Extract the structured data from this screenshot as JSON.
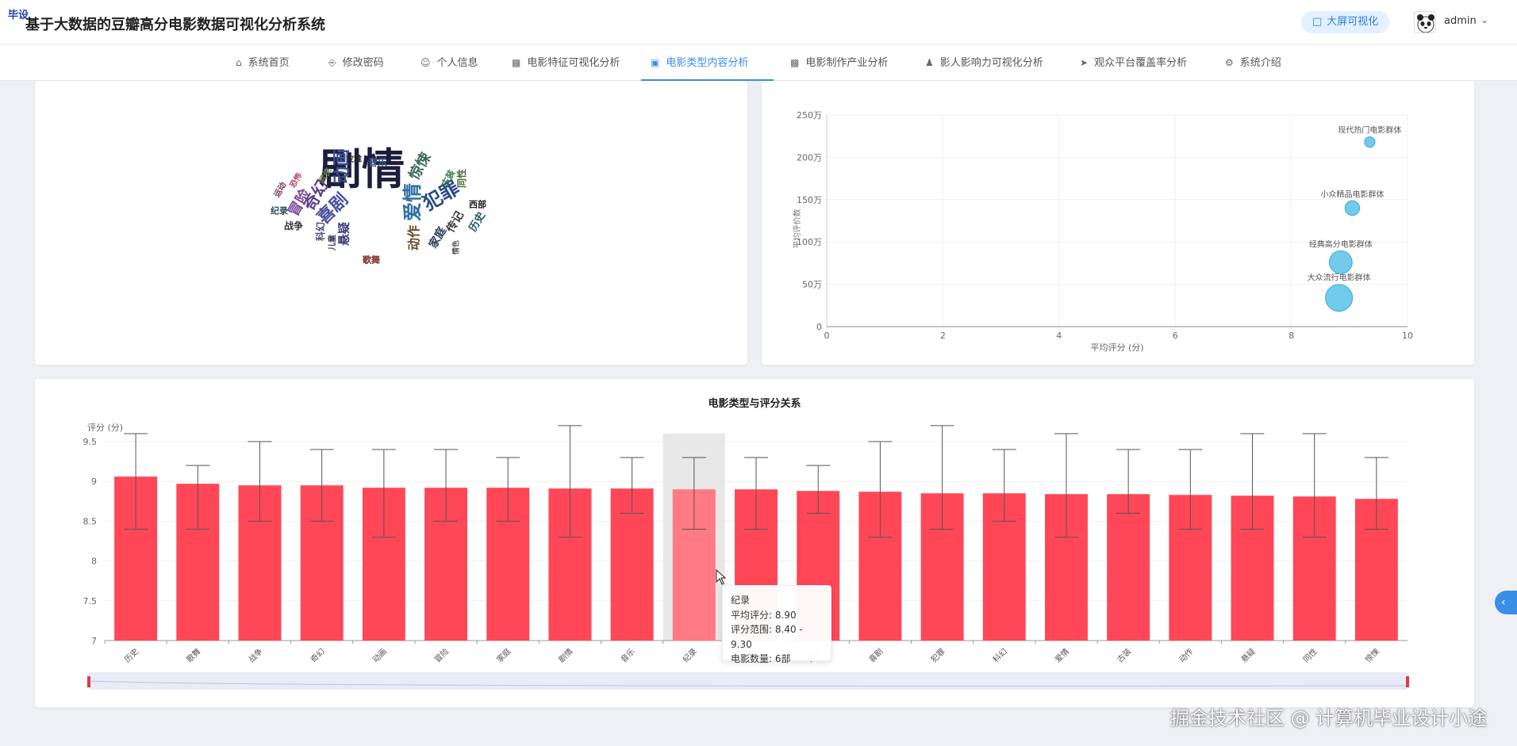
{
  "header": {
    "corner_logo": "毕设",
    "title": "基于大数据的豆瓣高分电影数据可视化分析系统",
    "bigscreen_label": "大屏可视化",
    "username": "admin"
  },
  "nav": [
    {
      "label": "系统首页",
      "icon": "home-icon"
    },
    {
      "label": "修改密码",
      "icon": "lock-icon"
    },
    {
      "label": "个人信息",
      "icon": "user-icon"
    },
    {
      "label": "电影特征可视化分析",
      "icon": "bar-chart-icon"
    },
    {
      "label": "电影类型内容分析",
      "icon": "chart-window-icon",
      "active": true
    },
    {
      "label": "电影制作产业分析",
      "icon": "monitor-icon"
    },
    {
      "label": "影人影响力可视化分析",
      "icon": "person-icon"
    },
    {
      "label": "观众平台覆盖率分析",
      "icon": "paper-plane-icon"
    },
    {
      "label": "系统介绍",
      "icon": "gear-icon"
    }
  ],
  "word_cloud": {
    "words": [
      "剧情",
      "爱情",
      "犯罪",
      "动画",
      "奇幻",
      "喜剧",
      "惊悚",
      "冒险",
      "悬疑",
      "动作",
      "家庭",
      "传记",
      "历史",
      "同性",
      "古装",
      "西部",
      "音乐",
      "灾难",
      "武侠",
      "恐怖",
      "运动",
      "纪录",
      "战争",
      "科幻",
      "歌舞",
      "情色",
      "儿童",
      "歌舞"
    ]
  },
  "scatter": {
    "x_axis_label": "平均评分 (分)",
    "y_axis_label": "平均评价数",
    "y_ticks": [
      "0",
      "50万",
      "100万",
      "150万",
      "200万",
      "250万"
    ],
    "x_ticks": [
      "0",
      "2",
      "4",
      "6",
      "8",
      "10"
    ],
    "chart_data": {
      "type": "scatter",
      "xlim": [
        0,
        10
      ],
      "ylim": [
        0,
        2500000
      ],
      "points": [
        {
          "label": "现代热门电影群体",
          "x": 9.35,
          "y": 2180000,
          "size": 1
        },
        {
          "label": "小众精品电影群体",
          "x": 9.05,
          "y": 1400000,
          "size": 2
        },
        {
          "label": "经典高分电影群体",
          "x": 8.85,
          "y": 760000,
          "size": 4
        },
        {
          "label": "大众流行电影群体",
          "x": 8.82,
          "y": 340000,
          "size": 5
        }
      ]
    }
  },
  "bar_chart": {
    "title": "电影类型与评分关系",
    "y_axis_name": "评分 (分)",
    "y_ticks": [
      "7",
      "7.5",
      "8",
      "8.5",
      "9",
      "9.5"
    ],
    "bar_color": "#ff4757",
    "chart_data": {
      "type": "bar",
      "ylim": [
        7,
        9.8
      ],
      "categories": [
        "历史",
        "歌舞",
        "战争",
        "奇幻",
        "动画",
        "冒险",
        "家庭",
        "剧情",
        "音乐",
        "纪录",
        "同性",
        "传记",
        "喜剧",
        "犯罪",
        "科幻",
        "爱情",
        "古装",
        "动作",
        "悬疑",
        "同性",
        "惊悚"
      ],
      "values": [
        9.06,
        8.97,
        8.95,
        8.95,
        8.92,
        8.92,
        8.92,
        8.91,
        8.91,
        8.9,
        8.9,
        8.88,
        8.87,
        8.85,
        8.85,
        8.84,
        8.84,
        8.83,
        8.82,
        8.81,
        8.78
      ],
      "range_low": [
        8.4,
        8.4,
        8.5,
        8.5,
        8.3,
        8.5,
        8.5,
        8.3,
        8.6,
        8.4,
        8.4,
        8.6,
        8.3,
        8.4,
        8.5,
        8.3,
        8.6,
        8.4,
        8.4,
        8.3,
        8.4
      ],
      "range_high": [
        9.6,
        9.2,
        9.5,
        9.4,
        9.4,
        9.4,
        9.3,
        9.7,
        9.3,
        9.3,
        9.3,
        9.2,
        9.5,
        9.7,
        9.4,
        9.6,
        9.4,
        9.4,
        9.6,
        9.6,
        9.3
      ],
      "highlight_index": 9
    },
    "tooltip": {
      "name": "纪录",
      "avg": "平均评分: 8.90",
      "range": "评分范围: 8.40 - 9.30",
      "count": "电影数量: 6部"
    }
  },
  "watermark": "掘金技术社区 @ 计算机毕业设计小途"
}
